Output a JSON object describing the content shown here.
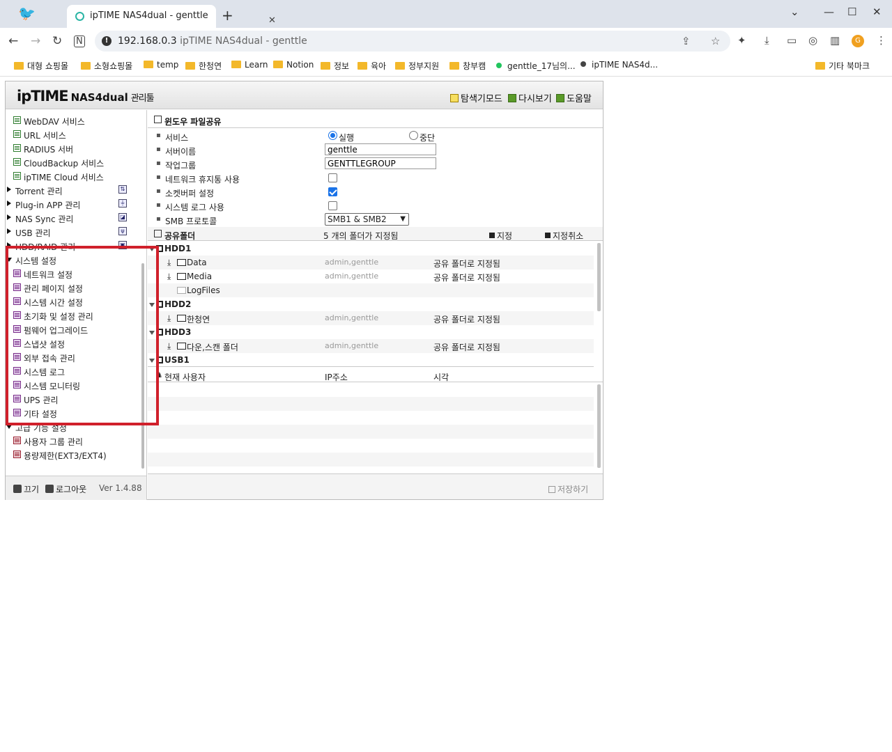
{
  "browser": {
    "tab_title": "ipTIME NAS4dual - genttle",
    "url_host": "192.168.0.3",
    "url_title": "ipTIME NAS4dual - genttle",
    "avatar_letter": "G",
    "bookmarks": [
      "대형 쇼핑몰",
      "소형쇼핑몰",
      "temp",
      "한청연",
      "Learn",
      "Notion",
      "정보",
      "육아",
      "정부지원",
      "창부캠",
      "genttle_17님의...",
      "ipTIME NAS4d..."
    ],
    "other_bookmarks": "기타 북마크"
  },
  "header": {
    "logo_main": "ipTIME",
    "logo_model": "NAS4dual",
    "logo_admin": "관리툴",
    "links": [
      "탐색기모드",
      "다시보기",
      "도움말"
    ]
  },
  "sidebar": {
    "items": [
      {
        "label": "WebDAV 서비스"
      },
      {
        "label": "URL 서비스"
      },
      {
        "label": "RADIUS 서버"
      },
      {
        "label": "CloudBackup 서비스"
      },
      {
        "label": "ipTIME Cloud 서비스"
      }
    ],
    "groups": [
      {
        "label": "Torrent 관리"
      },
      {
        "label": "Plug-in APP 관리"
      },
      {
        "label": "NAS Sync 관리"
      },
      {
        "label": "USB 관리"
      },
      {
        "label": "HDD/RAID 관리"
      }
    ],
    "system_group": "시스템 설정",
    "system_items": [
      "네트워크 설정",
      "관리 페이지 설정",
      "시스템 시간 설정",
      "초기화 및 설정 관리",
      "펌웨어 업그레이드",
      "스냅샷 설정",
      "외부 접속 관리",
      "시스템 로그",
      "시스템 모니터링",
      "UPS 관리",
      "기타 설정"
    ],
    "advanced_group": "고급 기능 설정",
    "advanced_items": [
      "사용자 그룹 관리",
      "용량제한(EXT3/EXT4)"
    ],
    "footer": {
      "power": "끄기",
      "logout": "로그아웃",
      "version": "Ver 1.4.88"
    }
  },
  "main": {
    "section_title": "윈도우 파일공유",
    "fields": {
      "service": "서비스",
      "service_on": "실행",
      "service_off": "중단",
      "server_name": "서버이름",
      "server_name_value": "genttle",
      "workgroup": "작업그룹",
      "workgroup_value": "GENTTLEGROUP",
      "recycle": "네트워크 휴지통 사용",
      "socket_buffer": "소켓버퍼 설정",
      "syslog": "시스템 로그 사용",
      "smb": "SMB 프로토콜",
      "smb_value": "SMB1 & SMB2"
    },
    "shares": {
      "title": "공유폴더",
      "count": "5  개의 폴더가 지정됨",
      "add": "지정",
      "remove": "지정취소"
    },
    "folders": [
      {
        "disk": "HDD1"
      },
      {
        "name": "Data",
        "users": "admin,genttle",
        "status": "공유 폴더로 지정됨"
      },
      {
        "name": "Media",
        "users": "admin,genttle",
        "status": "공유 폴더로 지정됨"
      },
      {
        "name": "LogFiles"
      },
      {
        "disk": "HDD2"
      },
      {
        "name": "한청연",
        "users": "admin,genttle",
        "status": "공유 폴더로 지정됨"
      },
      {
        "disk": "HDD3"
      },
      {
        "name": "다운,스캔 폴더",
        "users": "admin,genttle",
        "status": "공유 폴더로 지정됨"
      },
      {
        "disk": "USB1"
      }
    ],
    "users": {
      "col_user": "현재 사용자",
      "col_ip": "IP주소",
      "col_time": "시각"
    },
    "save": "저장하기"
  }
}
